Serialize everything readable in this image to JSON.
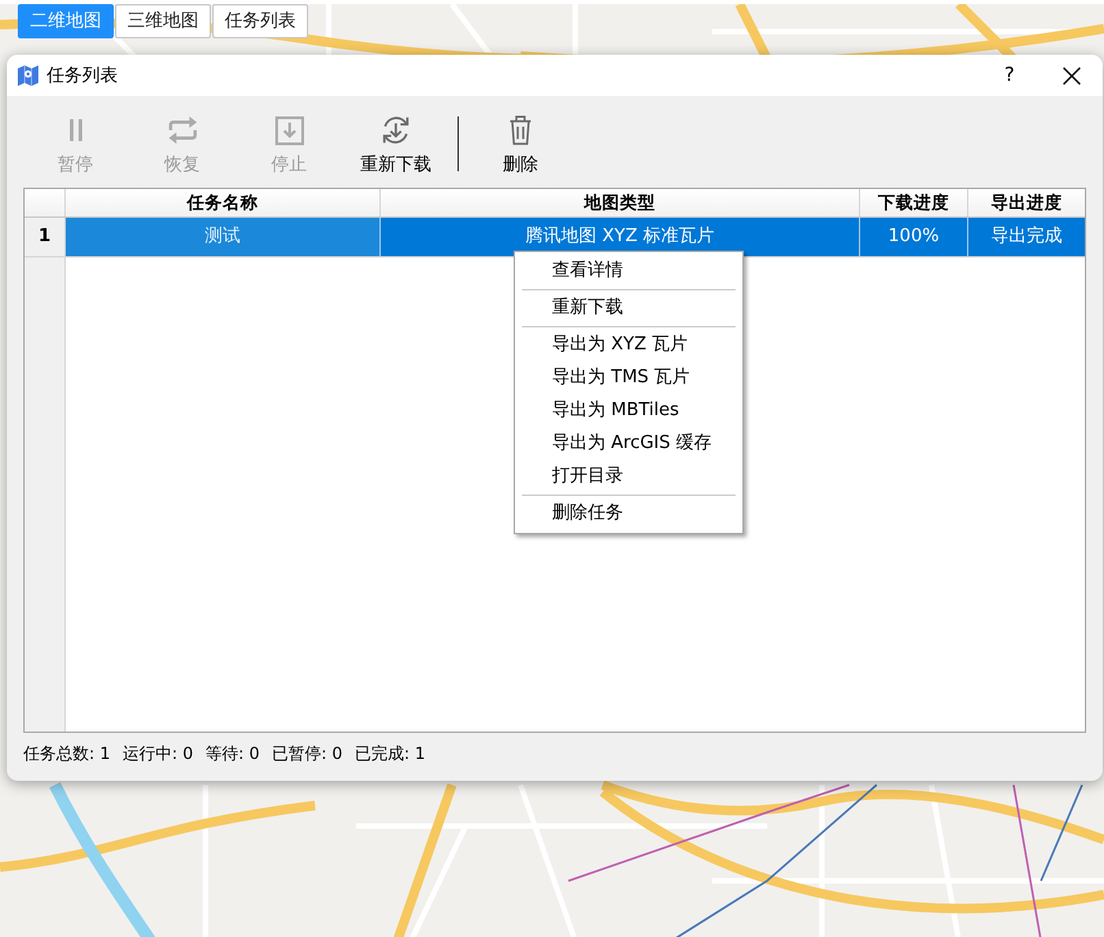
{
  "view_tabs": [
    {
      "label": "二维地图",
      "selected": true
    },
    {
      "label": "三维地图",
      "selected": false
    },
    {
      "label": "任务列表",
      "selected": false
    }
  ],
  "window": {
    "title": "任务列表",
    "help": "?"
  },
  "toolbar": [
    {
      "kind": "pause",
      "label": "暂停",
      "disabled": true
    },
    {
      "kind": "resume",
      "label": "恢复",
      "disabled": true
    },
    {
      "kind": "stop",
      "label": "停止",
      "disabled": true
    },
    {
      "kind": "redownload",
      "label": "重新下载",
      "disabled": false
    },
    {
      "kind": "separator"
    },
    {
      "kind": "delete",
      "label": "删除",
      "disabled": false
    }
  ],
  "table": {
    "columns": [
      "任务名称",
      "地图类型",
      "下载进度",
      "导出进度"
    ],
    "rows": [
      {
        "number": "1",
        "selected": true,
        "cells": [
          {
            "text": "测试",
            "focused": true
          },
          {
            "text": "腾讯地图 XYZ 标准瓦片",
            "focused": false
          },
          {
            "text": "100%",
            "focused": false
          },
          {
            "text": "导出完成",
            "focused": false
          }
        ]
      }
    ]
  },
  "context_menu": {
    "items": [
      {
        "kind": "item",
        "label": "查看详情"
      },
      {
        "kind": "separator"
      },
      {
        "kind": "item",
        "label": "重新下载"
      },
      {
        "kind": "separator"
      },
      {
        "kind": "item",
        "label": "导出为 XYZ 瓦片"
      },
      {
        "kind": "item",
        "label": "导出为 TMS 瓦片"
      },
      {
        "kind": "item",
        "label": "导出为 MBTiles"
      },
      {
        "kind": "item",
        "label": "导出为 ArcGIS 缓存"
      },
      {
        "kind": "item",
        "label": "打开目录"
      },
      {
        "kind": "separator"
      },
      {
        "kind": "item",
        "label": "删除任务"
      }
    ]
  },
  "status_bar": [
    "任务总数: 1",
    "运行中: 0",
    "等待: 0",
    "已暂停: 0",
    "已完成: 1"
  ]
}
